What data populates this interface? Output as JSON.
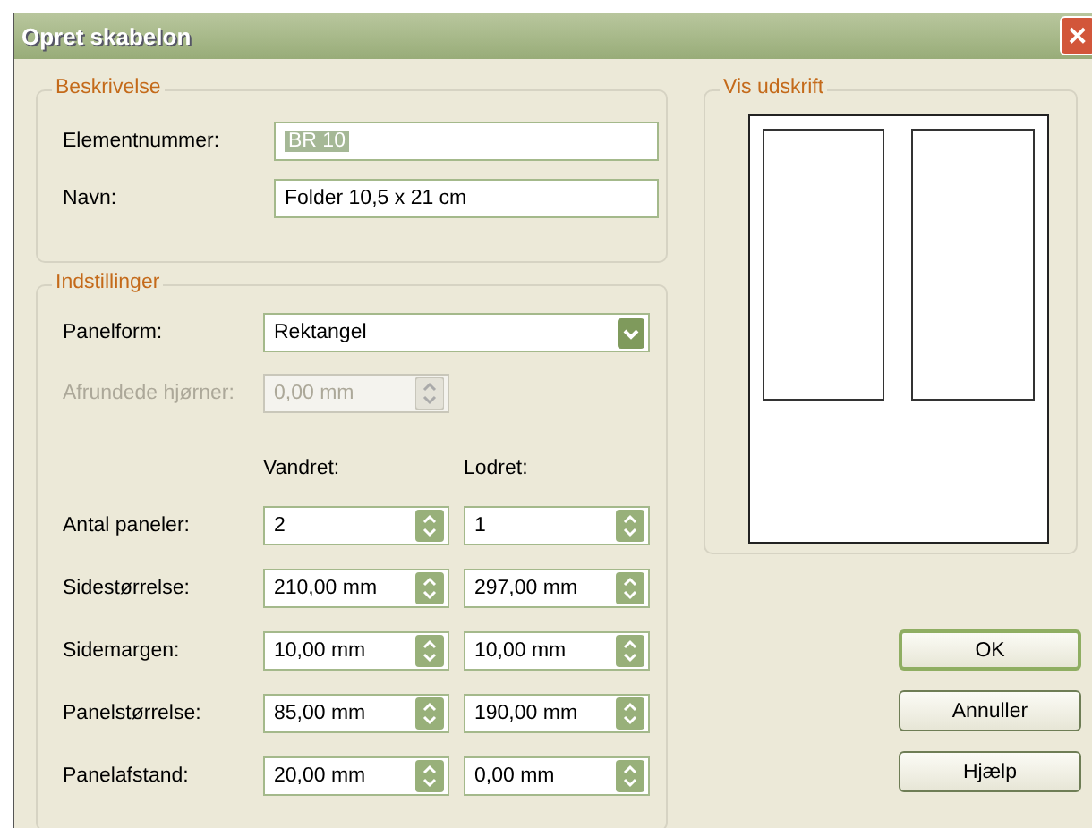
{
  "window": {
    "title": "Opret skabelon",
    "close": "✕"
  },
  "description": {
    "title": "Beskrivelse",
    "fields": [
      {
        "label": "Elementnummer:",
        "value": "BR 10",
        "highlighted": true
      },
      {
        "label": "Navn:",
        "value": "Folder 10,5 x 21 cm",
        "highlighted": false
      }
    ]
  },
  "settings": {
    "title": "Indstillinger",
    "panel_shape": {
      "label": "Panelform:",
      "value": "Rektangel"
    },
    "rounded_corners": {
      "label": "Afrundede hjørner:",
      "value": "0,00 mm",
      "disabled": true
    },
    "columns": [
      "Vandret:",
      "Lodret:"
    ],
    "rows": [
      {
        "label": "Antal paneler:",
        "horizontal": "2",
        "vertical": "1"
      },
      {
        "label": "Sidestørrelse:",
        "horizontal": "210,00 mm",
        "vertical": "297,00 mm"
      },
      {
        "label": "Sidemargen:",
        "horizontal": "10,00 mm",
        "vertical": "10,00 mm"
      },
      {
        "label": "Panelstørrelse:",
        "horizontal": "85,00 mm",
        "vertical": "190,00 mm"
      },
      {
        "label": "Panelafstand:",
        "horizontal": "20,00 mm",
        "vertical": "0,00 mm"
      }
    ]
  },
  "preview": {
    "title": "Vis udskrift"
  },
  "buttons": [
    {
      "label": "OK",
      "default": true
    },
    {
      "label": "Annuller",
      "default": false
    },
    {
      "label": "Hjælp",
      "default": false
    }
  ]
}
